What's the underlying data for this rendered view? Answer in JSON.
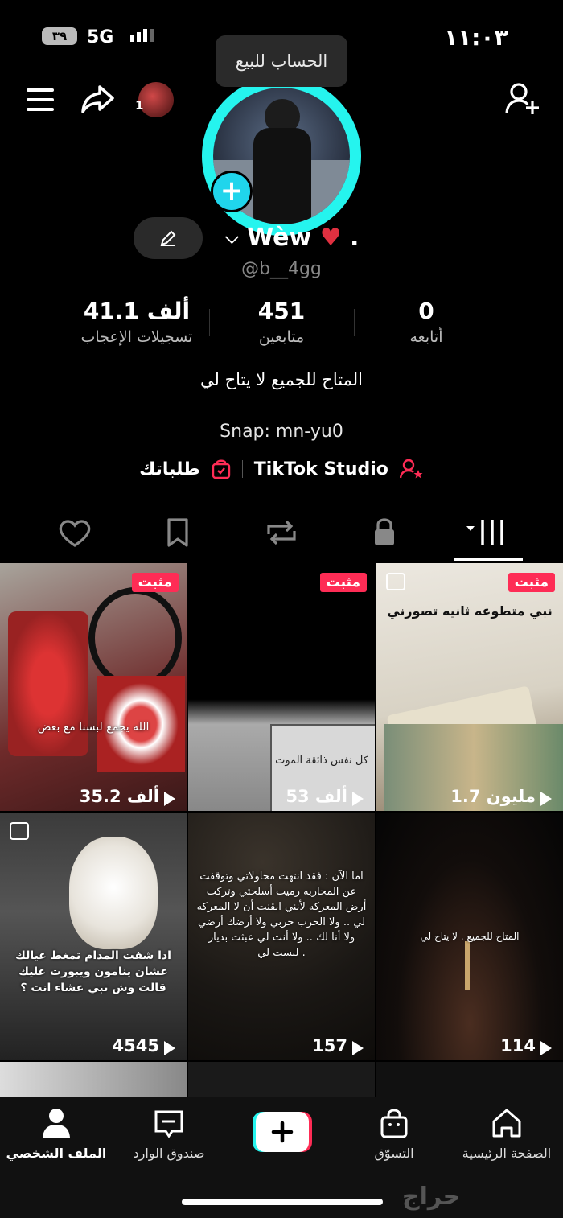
{
  "status_bar": {
    "time": "١١:٠٣",
    "network": "5G",
    "battery": "٣٩"
  },
  "tooltip": "الحساب للبيع",
  "profile": {
    "small_avatar_count": "1",
    "display_name": "Wèw",
    "display_suffix": ".",
    "handle": "@b__4gg",
    "edit_icon": "pencil-icon"
  },
  "stats": [
    {
      "value": "41.1 ألف",
      "label": "تسجيلات الإعجاب"
    },
    {
      "value": "451",
      "label": "متابعين"
    },
    {
      "value": "0",
      "label": "أتابعه"
    }
  ],
  "bio": "المتاح للجميع لا يتاح لي",
  "snap": "Snap:  mn-yu0",
  "links": {
    "orders": "طلباتك",
    "studio": "TikTok Studio"
  },
  "tabs": [
    "liked-icon",
    "favorites-icon",
    "reposts-icon",
    "private-icon",
    "videos-icon"
  ],
  "grid": [
    {
      "pinned": "مثبت",
      "views": "35.2 ألف",
      "caption": "الله يجمع لبسنا مع بعض",
      "multi": false
    },
    {
      "pinned": "مثبت",
      "views": "53 ألف",
      "caption": "كل نفس ذائقة الموت",
      "multi": false
    },
    {
      "pinned": "مثبت",
      "views": "1.7 مليون",
      "caption": "نبي متطوعه ثانيه تصورني",
      "multi": true
    },
    {
      "pinned": "",
      "views": "4545",
      "caption": "اذا شفت المدام تمغط عيالك عشان ينامون ويبورت عليك قالت وش تبي عشاء انت ؟",
      "multi": true
    },
    {
      "pinned": "",
      "views": "157",
      "caption": "اما الآن : فقد انتهت محاولاتي وتوقفت عن المحاربه رميت أسلحتي وتركت أرض المعركه لأنني ايقنت أن لا المعركه لي .. ولا الحرب حربي ولا أرضك أرضي ولا أنا لك .. ولا أنت لي عبثت بديار ليست لي .",
      "multi": false
    },
    {
      "pinned": "",
      "views": "114",
      "caption": "المتاح للجميع . لا يتاح لي",
      "multi": false
    }
  ],
  "nav": {
    "profile": "الملف الشخصي",
    "inbox": "صندوق الوارد",
    "shop": "التسوّق",
    "home": "الصفحة الرئيسية"
  },
  "watermark": "حراج",
  "colors": {
    "accent_cyan": "#25f4ee",
    "accent_red": "#fe2c55",
    "background": "#000000"
  }
}
